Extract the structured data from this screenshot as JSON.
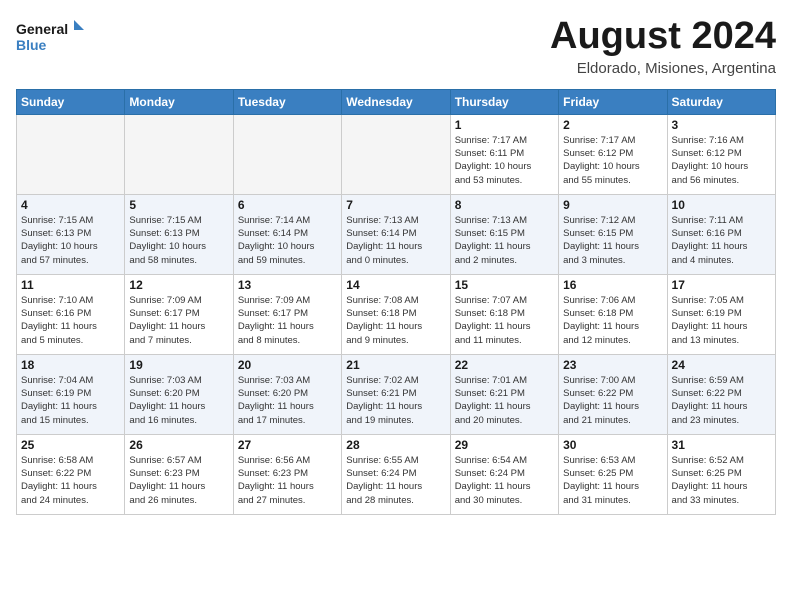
{
  "logo": {
    "line1": "General",
    "line2": "Blue"
  },
  "title": "August 2024",
  "subtitle": "Eldorado, Misiones, Argentina",
  "weekdays": [
    "Sunday",
    "Monday",
    "Tuesday",
    "Wednesday",
    "Thursday",
    "Friday",
    "Saturday"
  ],
  "weeks": [
    [
      {
        "day": "",
        "info": ""
      },
      {
        "day": "",
        "info": ""
      },
      {
        "day": "",
        "info": ""
      },
      {
        "day": "",
        "info": ""
      },
      {
        "day": "1",
        "info": "Sunrise: 7:17 AM\nSunset: 6:11 PM\nDaylight: 10 hours\nand 53 minutes."
      },
      {
        "day": "2",
        "info": "Sunrise: 7:17 AM\nSunset: 6:12 PM\nDaylight: 10 hours\nand 55 minutes."
      },
      {
        "day": "3",
        "info": "Sunrise: 7:16 AM\nSunset: 6:12 PM\nDaylight: 10 hours\nand 56 minutes."
      }
    ],
    [
      {
        "day": "4",
        "info": "Sunrise: 7:15 AM\nSunset: 6:13 PM\nDaylight: 10 hours\nand 57 minutes."
      },
      {
        "day": "5",
        "info": "Sunrise: 7:15 AM\nSunset: 6:13 PM\nDaylight: 10 hours\nand 58 minutes."
      },
      {
        "day": "6",
        "info": "Sunrise: 7:14 AM\nSunset: 6:14 PM\nDaylight: 10 hours\nand 59 minutes."
      },
      {
        "day": "7",
        "info": "Sunrise: 7:13 AM\nSunset: 6:14 PM\nDaylight: 11 hours\nand 0 minutes."
      },
      {
        "day": "8",
        "info": "Sunrise: 7:13 AM\nSunset: 6:15 PM\nDaylight: 11 hours\nand 2 minutes."
      },
      {
        "day": "9",
        "info": "Sunrise: 7:12 AM\nSunset: 6:15 PM\nDaylight: 11 hours\nand 3 minutes."
      },
      {
        "day": "10",
        "info": "Sunrise: 7:11 AM\nSunset: 6:16 PM\nDaylight: 11 hours\nand 4 minutes."
      }
    ],
    [
      {
        "day": "11",
        "info": "Sunrise: 7:10 AM\nSunset: 6:16 PM\nDaylight: 11 hours\nand 5 minutes."
      },
      {
        "day": "12",
        "info": "Sunrise: 7:09 AM\nSunset: 6:17 PM\nDaylight: 11 hours\nand 7 minutes."
      },
      {
        "day": "13",
        "info": "Sunrise: 7:09 AM\nSunset: 6:17 PM\nDaylight: 11 hours\nand 8 minutes."
      },
      {
        "day": "14",
        "info": "Sunrise: 7:08 AM\nSunset: 6:18 PM\nDaylight: 11 hours\nand 9 minutes."
      },
      {
        "day": "15",
        "info": "Sunrise: 7:07 AM\nSunset: 6:18 PM\nDaylight: 11 hours\nand 11 minutes."
      },
      {
        "day": "16",
        "info": "Sunrise: 7:06 AM\nSunset: 6:18 PM\nDaylight: 11 hours\nand 12 minutes."
      },
      {
        "day": "17",
        "info": "Sunrise: 7:05 AM\nSunset: 6:19 PM\nDaylight: 11 hours\nand 13 minutes."
      }
    ],
    [
      {
        "day": "18",
        "info": "Sunrise: 7:04 AM\nSunset: 6:19 PM\nDaylight: 11 hours\nand 15 minutes."
      },
      {
        "day": "19",
        "info": "Sunrise: 7:03 AM\nSunset: 6:20 PM\nDaylight: 11 hours\nand 16 minutes."
      },
      {
        "day": "20",
        "info": "Sunrise: 7:03 AM\nSunset: 6:20 PM\nDaylight: 11 hours\nand 17 minutes."
      },
      {
        "day": "21",
        "info": "Sunrise: 7:02 AM\nSunset: 6:21 PM\nDaylight: 11 hours\nand 19 minutes."
      },
      {
        "day": "22",
        "info": "Sunrise: 7:01 AM\nSunset: 6:21 PM\nDaylight: 11 hours\nand 20 minutes."
      },
      {
        "day": "23",
        "info": "Sunrise: 7:00 AM\nSunset: 6:22 PM\nDaylight: 11 hours\nand 21 minutes."
      },
      {
        "day": "24",
        "info": "Sunrise: 6:59 AM\nSunset: 6:22 PM\nDaylight: 11 hours\nand 23 minutes."
      }
    ],
    [
      {
        "day": "25",
        "info": "Sunrise: 6:58 AM\nSunset: 6:22 PM\nDaylight: 11 hours\nand 24 minutes."
      },
      {
        "day": "26",
        "info": "Sunrise: 6:57 AM\nSunset: 6:23 PM\nDaylight: 11 hours\nand 26 minutes."
      },
      {
        "day": "27",
        "info": "Sunrise: 6:56 AM\nSunset: 6:23 PM\nDaylight: 11 hours\nand 27 minutes."
      },
      {
        "day": "28",
        "info": "Sunrise: 6:55 AM\nSunset: 6:24 PM\nDaylight: 11 hours\nand 28 minutes."
      },
      {
        "day": "29",
        "info": "Sunrise: 6:54 AM\nSunset: 6:24 PM\nDaylight: 11 hours\nand 30 minutes."
      },
      {
        "day": "30",
        "info": "Sunrise: 6:53 AM\nSunset: 6:25 PM\nDaylight: 11 hours\nand 31 minutes."
      },
      {
        "day": "31",
        "info": "Sunrise: 6:52 AM\nSunset: 6:25 PM\nDaylight: 11 hours\nand 33 minutes."
      }
    ]
  ]
}
